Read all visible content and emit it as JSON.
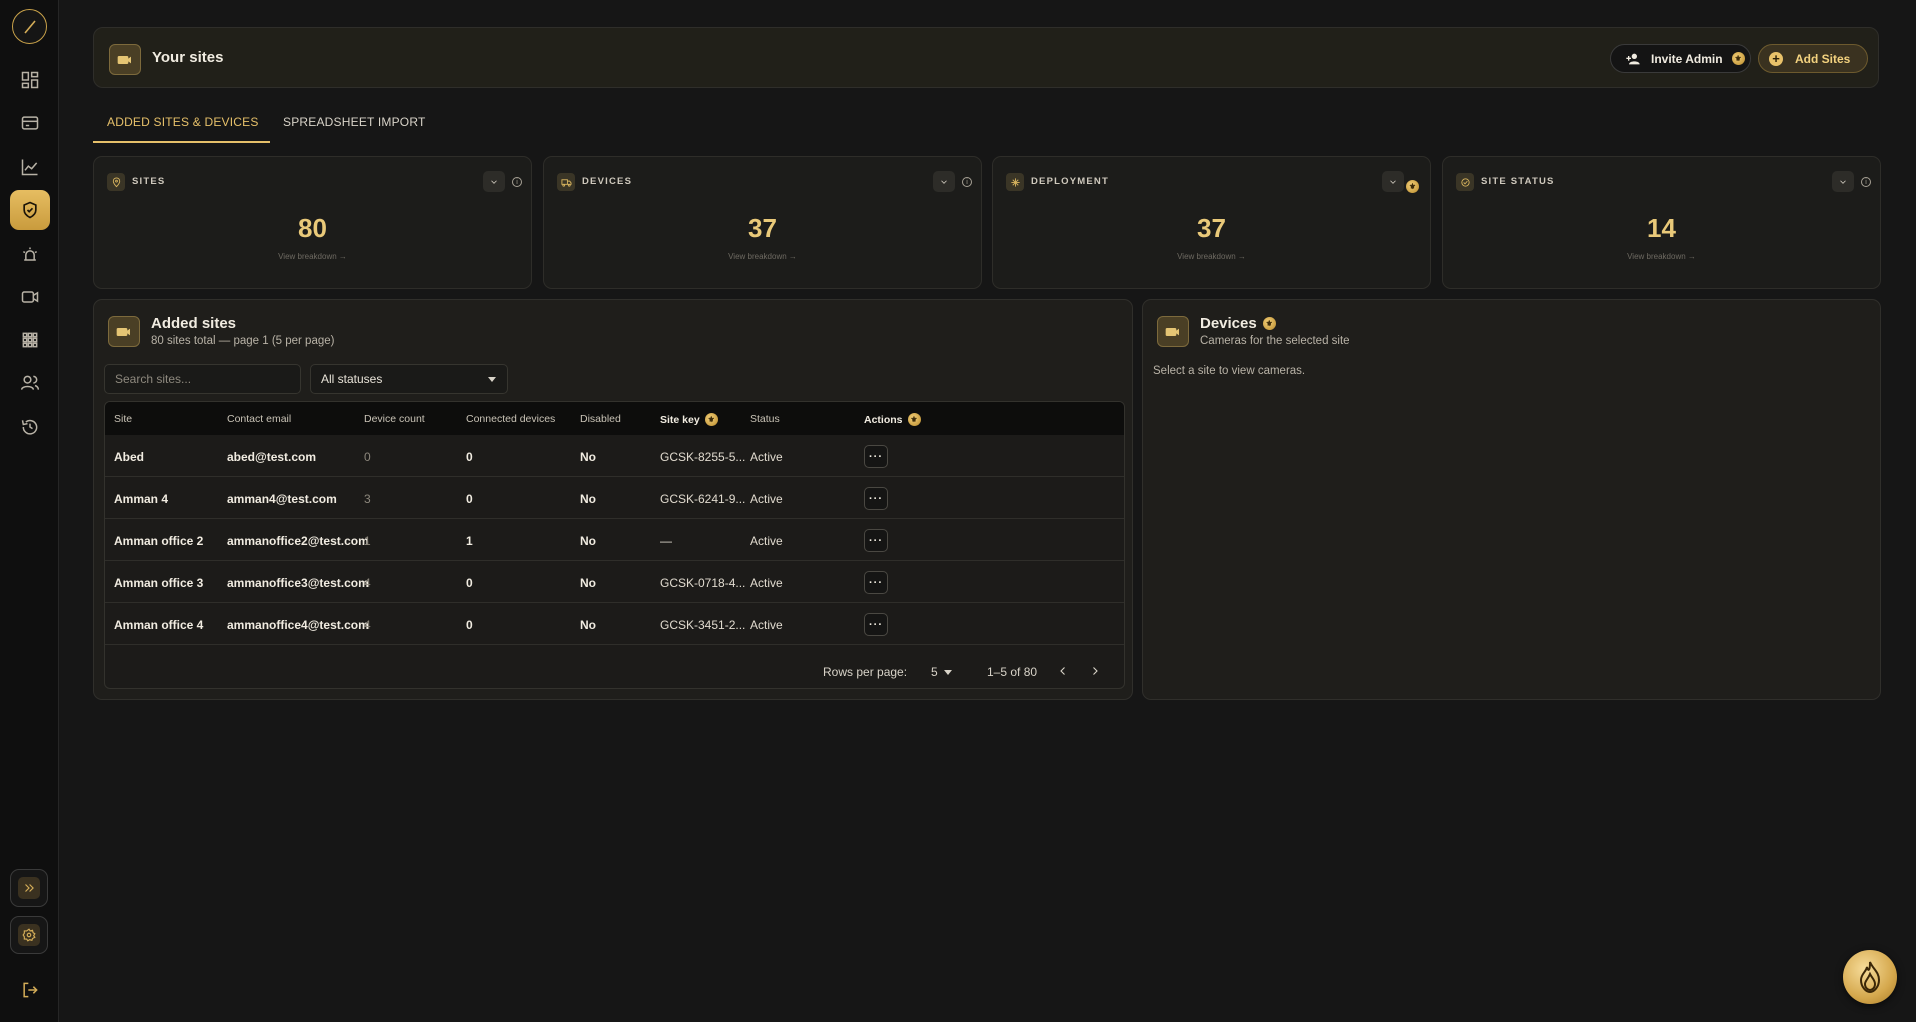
{
  "sidebar": {
    "items": [
      {
        "name": "dashboard-icon"
      },
      {
        "name": "card-icon"
      },
      {
        "name": "analytics-icon"
      },
      {
        "name": "shield-icon",
        "active": true
      },
      {
        "name": "alarm-icon"
      },
      {
        "name": "video-icon"
      },
      {
        "name": "grid-icon"
      },
      {
        "name": "users-icon"
      },
      {
        "name": "history-icon"
      }
    ],
    "bottom": [
      "expand-icon",
      "settings-icon",
      "logout-icon"
    ]
  },
  "header": {
    "title": "Your sites",
    "invite_label": "Invite Admin",
    "add_label": "Add Sites"
  },
  "tabs": [
    {
      "label": "ADDED SITES & DEVICES",
      "active": true
    },
    {
      "label": "SPREADSHEET IMPORT",
      "active": false
    }
  ],
  "stats": [
    {
      "label": "SITES",
      "value": "80",
      "link": "View breakdown →",
      "icon": "pin-icon"
    },
    {
      "label": "DEVICES",
      "value": "37",
      "link": "View breakdown →",
      "icon": "truck-icon"
    },
    {
      "label": "DEPLOYMENT",
      "value": "37",
      "link": "View breakdown →",
      "icon": "spark-icon"
    },
    {
      "label": "SITE STATUS",
      "value": "14",
      "link": "View breakdown →",
      "icon": "check-circle-icon"
    }
  ],
  "sites_panel": {
    "title": "Added sites",
    "subtitle": "80 sites total — page 1 (5 per page)",
    "search_placeholder": "Search sites...",
    "status_filter": "All statuses",
    "columns": [
      "Site",
      "Contact email",
      "Device count",
      "Connected devices",
      "Disabled",
      "Site key",
      "Status",
      "Actions"
    ],
    "rows": [
      {
        "site": "Abed",
        "email": "abed@test.com",
        "count": "0",
        "connected": "0",
        "disabled": "No",
        "key": "GCSK-8255-5...",
        "status": "Active",
        "action": "···"
      },
      {
        "site": "Amman 4",
        "email": "amman4@test.com",
        "count": "3",
        "connected": "0",
        "disabled": "No",
        "key": "GCSK-6241-9...",
        "status": "Active",
        "action": "···"
      },
      {
        "site": "Amman office 2",
        "email": "ammanoffice2@test.com",
        "count": "1",
        "connected": "1",
        "disabled": "No",
        "key": "—",
        "status": "Active",
        "action": "···"
      },
      {
        "site": "Amman office 3",
        "email": "ammanoffice3@test.com",
        "count": "4",
        "connected": "0",
        "disabled": "No",
        "key": "GCSK-0718-4...",
        "status": "Active",
        "action": "···"
      },
      {
        "site": "Amman office 4",
        "email": "ammanoffice4@test.com",
        "count": "4",
        "connected": "0",
        "disabled": "No",
        "key": "GCSK-3451-2...",
        "status": "Active",
        "action": "···"
      }
    ],
    "rows_per_page_label": "Rows per page:",
    "rows_per_page": "5",
    "range": "1–5 of 80"
  },
  "devices_panel": {
    "title": "Devices",
    "subtitle": "Cameras for the selected site",
    "empty": "Select a site to view cameras."
  },
  "colors": {
    "accent": "#e6c06a",
    "background": "#161616",
    "panel": "#1f1e1b"
  }
}
